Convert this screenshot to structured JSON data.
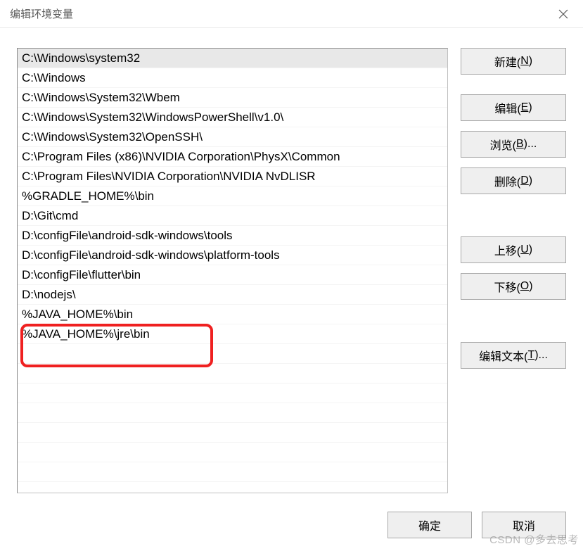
{
  "titlebar": {
    "title": "编辑环境变量"
  },
  "paths": [
    "C:\\Windows\\system32",
    "C:\\Windows",
    "C:\\Windows\\System32\\Wbem",
    "C:\\Windows\\System32\\WindowsPowerShell\\v1.0\\",
    "C:\\Windows\\System32\\OpenSSH\\",
    "C:\\Program Files (x86)\\NVIDIA Corporation\\PhysX\\Common",
    "C:\\Program Files\\NVIDIA Corporation\\NVIDIA NvDLISR",
    "%GRADLE_HOME%\\bin",
    "D:\\Git\\cmd",
    "D:\\configFile\\android-sdk-windows\\tools",
    "D:\\configFile\\android-sdk-windows\\platform-tools",
    "D:\\configFile\\flutter\\bin",
    "D:\\nodejs\\",
    "%JAVA_HOME%\\bin",
    "%JAVA_HOME%\\jre\\bin"
  ],
  "selected_index": 0,
  "buttons": {
    "new": {
      "text": "新建(",
      "mnemonic": "N",
      "tail": ")"
    },
    "edit": {
      "text": "编辑(",
      "mnemonic": "E",
      "tail": ")"
    },
    "browse": {
      "text": "浏览(",
      "mnemonic": "B",
      "tail": ")..."
    },
    "delete": {
      "text": "删除(",
      "mnemonic": "D",
      "tail": ")"
    },
    "move_up": {
      "text": "上移(",
      "mnemonic": "U",
      "tail": ")"
    },
    "move_down": {
      "text": "下移(",
      "mnemonic": "O",
      "tail": ")"
    },
    "edit_text": {
      "text": "编辑文本(",
      "mnemonic": "T",
      "tail": ")..."
    },
    "ok": {
      "label": "确定"
    },
    "cancel": {
      "label": "取消"
    }
  },
  "watermark": "CSDN @多去思考"
}
